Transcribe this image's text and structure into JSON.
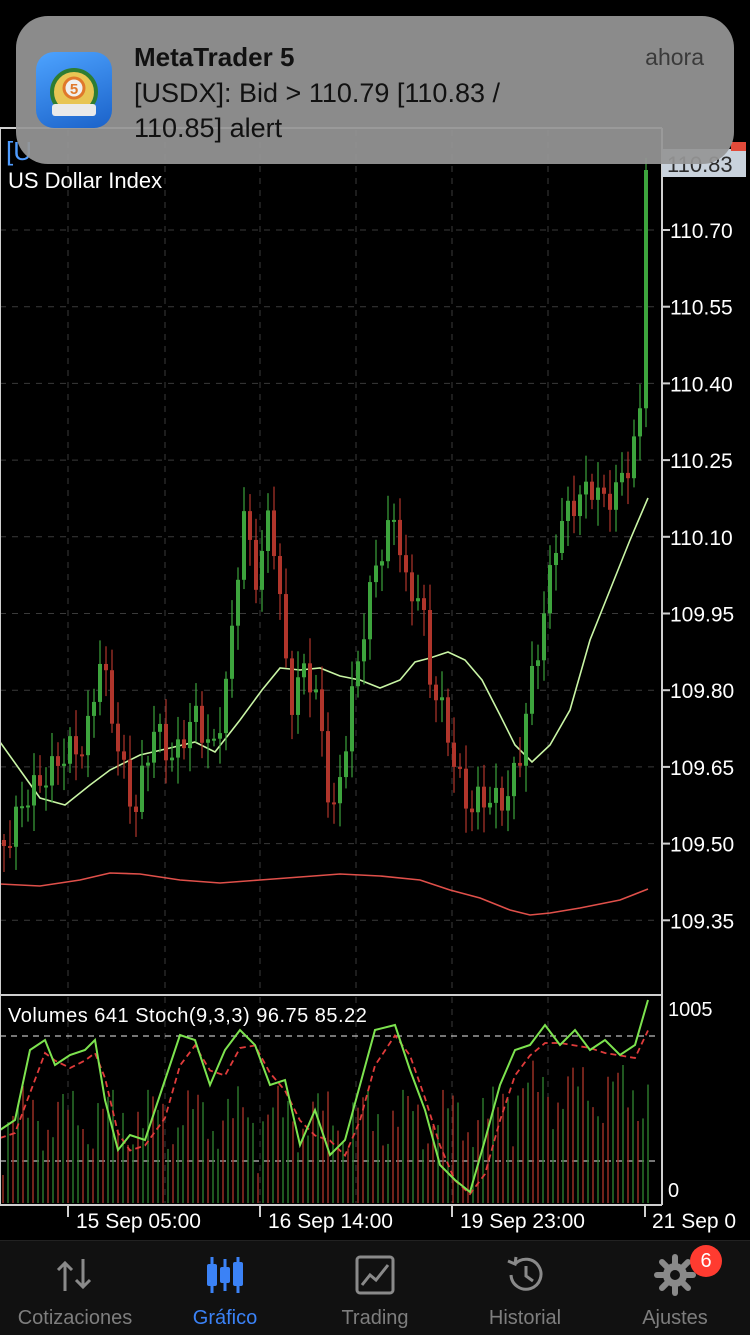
{
  "notification": {
    "app": "MetaTrader 5",
    "time": "ahora",
    "message": "[USDX]: Bid > 110.79 [110.83 / 110.85] alert"
  },
  "chart": {
    "symbol_tag": "[U",
    "instrument": "US Dollar Index",
    "current_price": "110.83",
    "price_axis": [
      "110.70",
      "110.55",
      "110.40",
      "110.25",
      "110.10",
      "109.95",
      "109.80",
      "109.65",
      "109.50",
      "109.35"
    ],
    "time_axis": [
      "15 Sep 05:00",
      "16 Sep 14:00",
      "19 Sep 23:00",
      "21 Sep 0"
    ],
    "indicator_label": "Volumes 641 Stoch(9,3,3) 96.75 85.22",
    "indicator_scale": [
      "1005",
      "0"
    ],
    "colors": {
      "bull": "#3da43d",
      "bear": "#b0352b",
      "ma_fast": "#c9f5a5",
      "ma_slow": "#e0504a",
      "stoch_main": "#7de34f",
      "stoch_signal": "#e03b3b"
    }
  },
  "tabbar": {
    "tabs": [
      {
        "label": "Cotizaciones",
        "icon": "quotes-arrows-icon"
      },
      {
        "label": "Gráfico",
        "icon": "candlestick-chart-icon"
      },
      {
        "label": "Trading",
        "icon": "trading-chart-icon"
      },
      {
        "label": "Historial",
        "icon": "history-clock-icon"
      },
      {
        "label": "Ajustes",
        "icon": "gear-icon",
        "badge": "6"
      }
    ],
    "active_tab": "Gráfico"
  }
}
